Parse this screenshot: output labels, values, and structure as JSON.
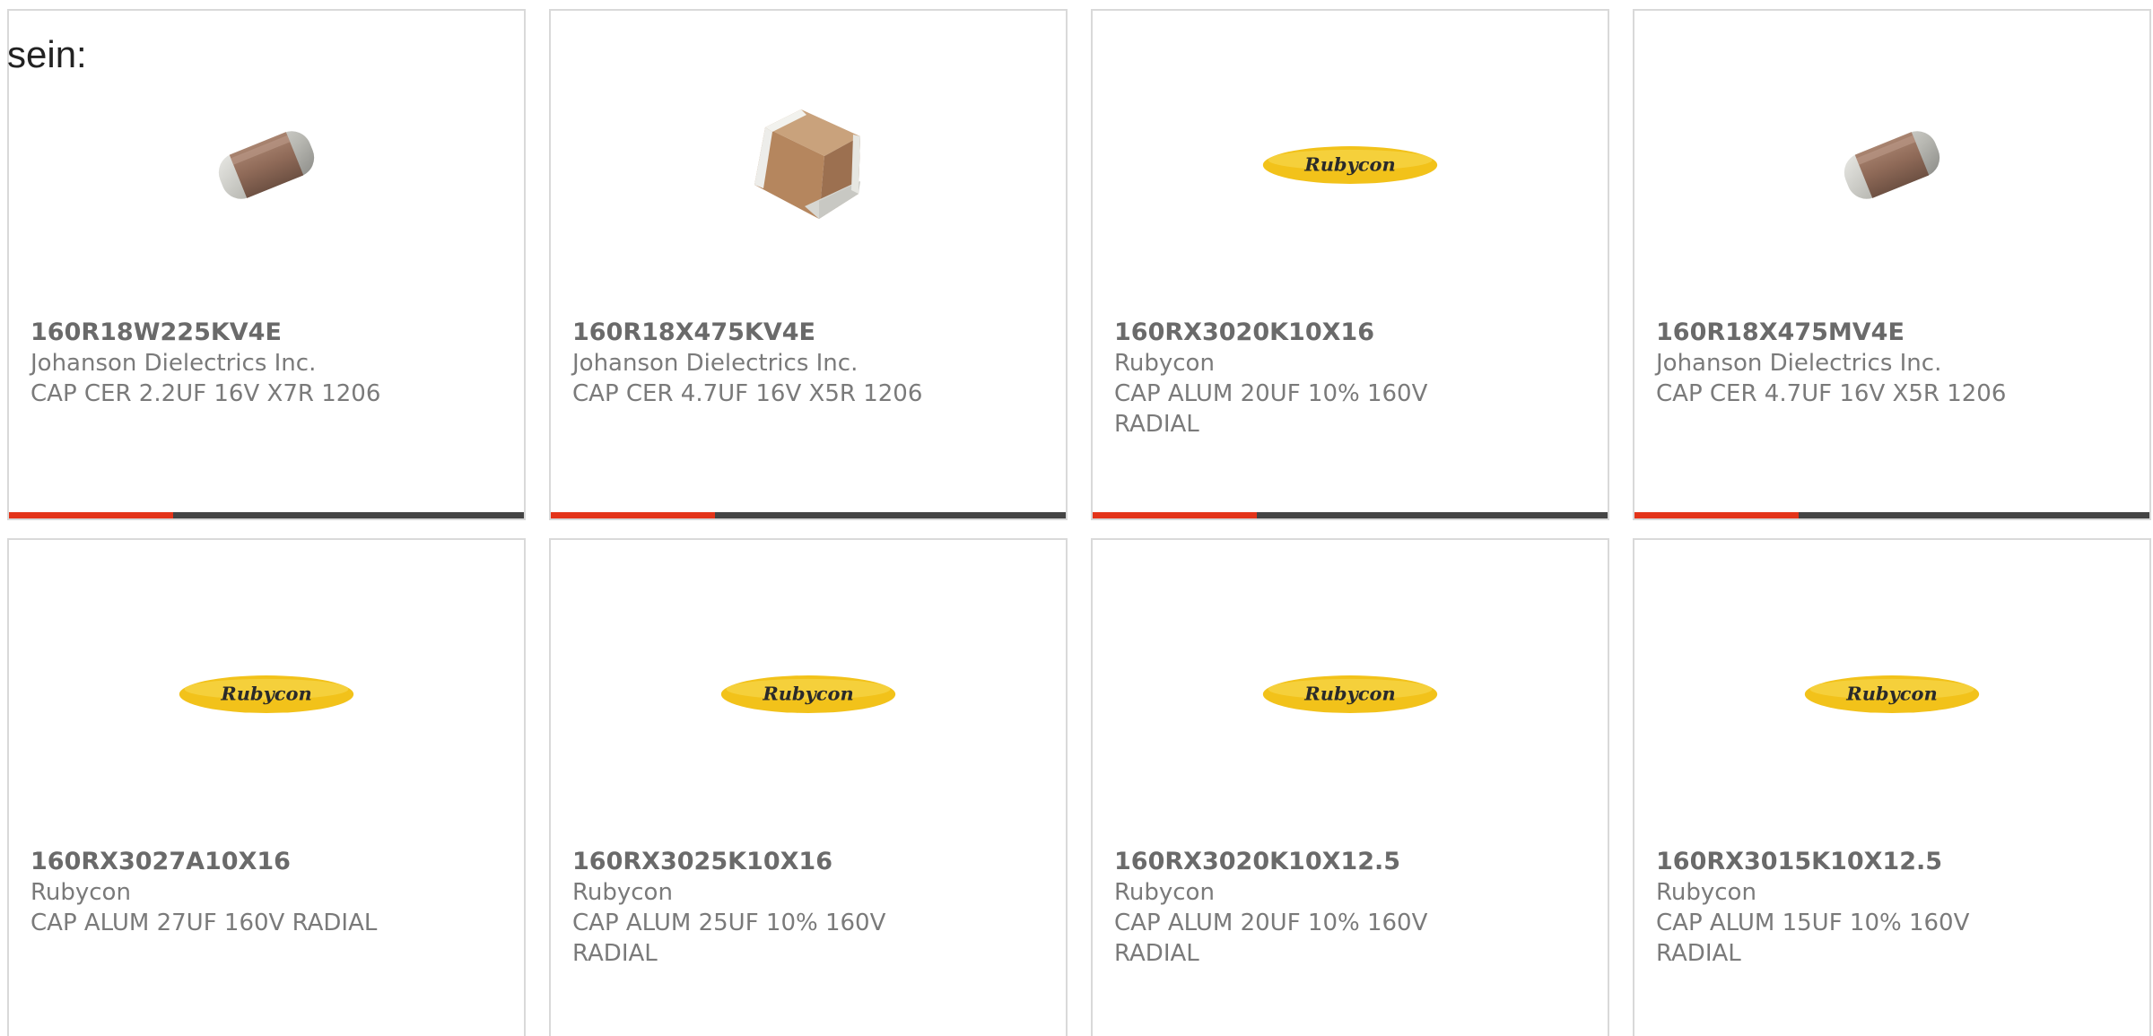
{
  "intro_text": "sein:",
  "colors": {
    "accent": "#e3341a",
    "bar": "#444444",
    "logo_yellow": "#f2c21a",
    "card_border": "#d9d9d9"
  },
  "products": [
    {
      "part_number": "160R18W225KV4E",
      "manufacturer": "Johanson Dielectrics Inc.",
      "description": "CAP CER 2.2UF 16V X7R 1206",
      "image": "ceramic-capacitor-icon",
      "has_bar": true
    },
    {
      "part_number": "160R18X475KV4E",
      "manufacturer": "Johanson Dielectrics Inc.",
      "description": "CAP CER 4.7UF 16V X5R 1206",
      "image": "ceramic-chip-icon",
      "has_bar": true
    },
    {
      "part_number": "160RX3020K10X16",
      "manufacturer": "Rubycon",
      "description": "CAP ALUM 20UF 10% 160V RADIAL",
      "image": "rubycon-logo",
      "logo_text": "Rubycon",
      "has_bar": true
    },
    {
      "part_number": "160R18X475MV4E",
      "manufacturer": "Johanson Dielectrics Inc.",
      "description": "CAP CER 4.7UF 16V X5R 1206",
      "image": "ceramic-capacitor-icon",
      "has_bar": true
    },
    {
      "part_number": "160RX3027A10X16",
      "manufacturer": "Rubycon",
      "description": "CAP ALUM 27UF 160V RADIAL",
      "image": "rubycon-logo",
      "logo_text": "Rubycon",
      "has_bar": false
    },
    {
      "part_number": "160RX3025K10X16",
      "manufacturer": "Rubycon",
      "description": "CAP ALUM 25UF 10% 160V RADIAL",
      "image": "rubycon-logo",
      "logo_text": "Rubycon",
      "has_bar": false
    },
    {
      "part_number": "160RX3020K10X12.5",
      "manufacturer": "Rubycon",
      "description": "CAP ALUM 20UF 10% 160V RADIAL",
      "image": "rubycon-logo",
      "logo_text": "Rubycon",
      "has_bar": false
    },
    {
      "part_number": "160RX3015K10X12.5",
      "manufacturer": "Rubycon",
      "description": "CAP ALUM 15UF 10% 160V RADIAL",
      "image": "rubycon-logo",
      "logo_text": "Rubycon",
      "has_bar": false
    }
  ]
}
